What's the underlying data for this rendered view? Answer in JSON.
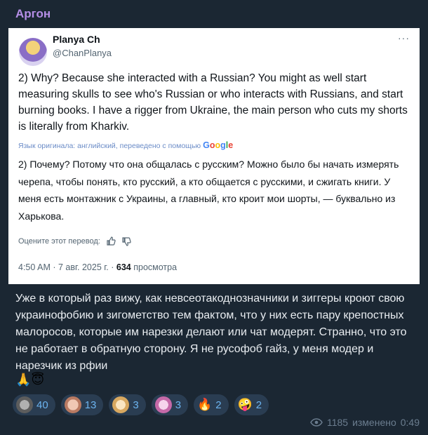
{
  "channel": {
    "name": "Аргон"
  },
  "tweet": {
    "author_name": "Planya Ch",
    "author_handle": "@ChanPlanya",
    "more_glyph": "···",
    "text": "2) Why? Because she interacted with a Russian? You might as well start measuring skulls to see who's Russian or who interacts with Russians, and start burning books. I have a rigger from Ukraine, the main person who cuts my shorts is literally from Kharkiv.",
    "translation_note": "Язык оригинала: английский, переведено с помощью",
    "translation_provider": "Google",
    "translated_text": "2) Почему? Потому что она общалась с русским? Можно было бы начать измерять черепа, чтобы понять, кто русский, а кто общается с русскими, и сжигать книги. У меня есть монтажник с Украины, а главный, кто кроит мои шорты, — буквально из Харькова.",
    "rate_label": "Оцените этот перевод:",
    "time": "4:50 AM",
    "date": "7 авг. 2025 г.",
    "views_count": "634",
    "views_label": "просмотра"
  },
  "message": {
    "text": "Уже в который раз вижу, как невсеотакоднозначники и зиггеры кроют свою украинофобию и зигометство тем фактом, что у них есть пару крепостных малоросов, которые им нарезки делают или чат модерят. Странно, что это не работает в обратную сторону. Я не русофоб гайз, у меня модер и нарезчик из рфии",
    "trailing_emoji": "🙏😇"
  },
  "reactions": [
    {
      "icon": "custom-sticker-gray",
      "count": "40",
      "color": "#8c8c8c"
    },
    {
      "icon": "custom-sticker-face",
      "count": "13",
      "color": "#e0b4a0"
    },
    {
      "icon": "custom-sticker-anime-blond",
      "count": "3",
      "color": "#f0d6a0"
    },
    {
      "icon": "custom-sticker-anime-pink",
      "count": "3",
      "color": "#e6a6d6"
    },
    {
      "emoji": "🔥",
      "count": "2"
    },
    {
      "emoji": "🤪",
      "count": "2"
    }
  ],
  "footer": {
    "views": "1185",
    "edited_label": "изменено",
    "time": "0:49"
  }
}
